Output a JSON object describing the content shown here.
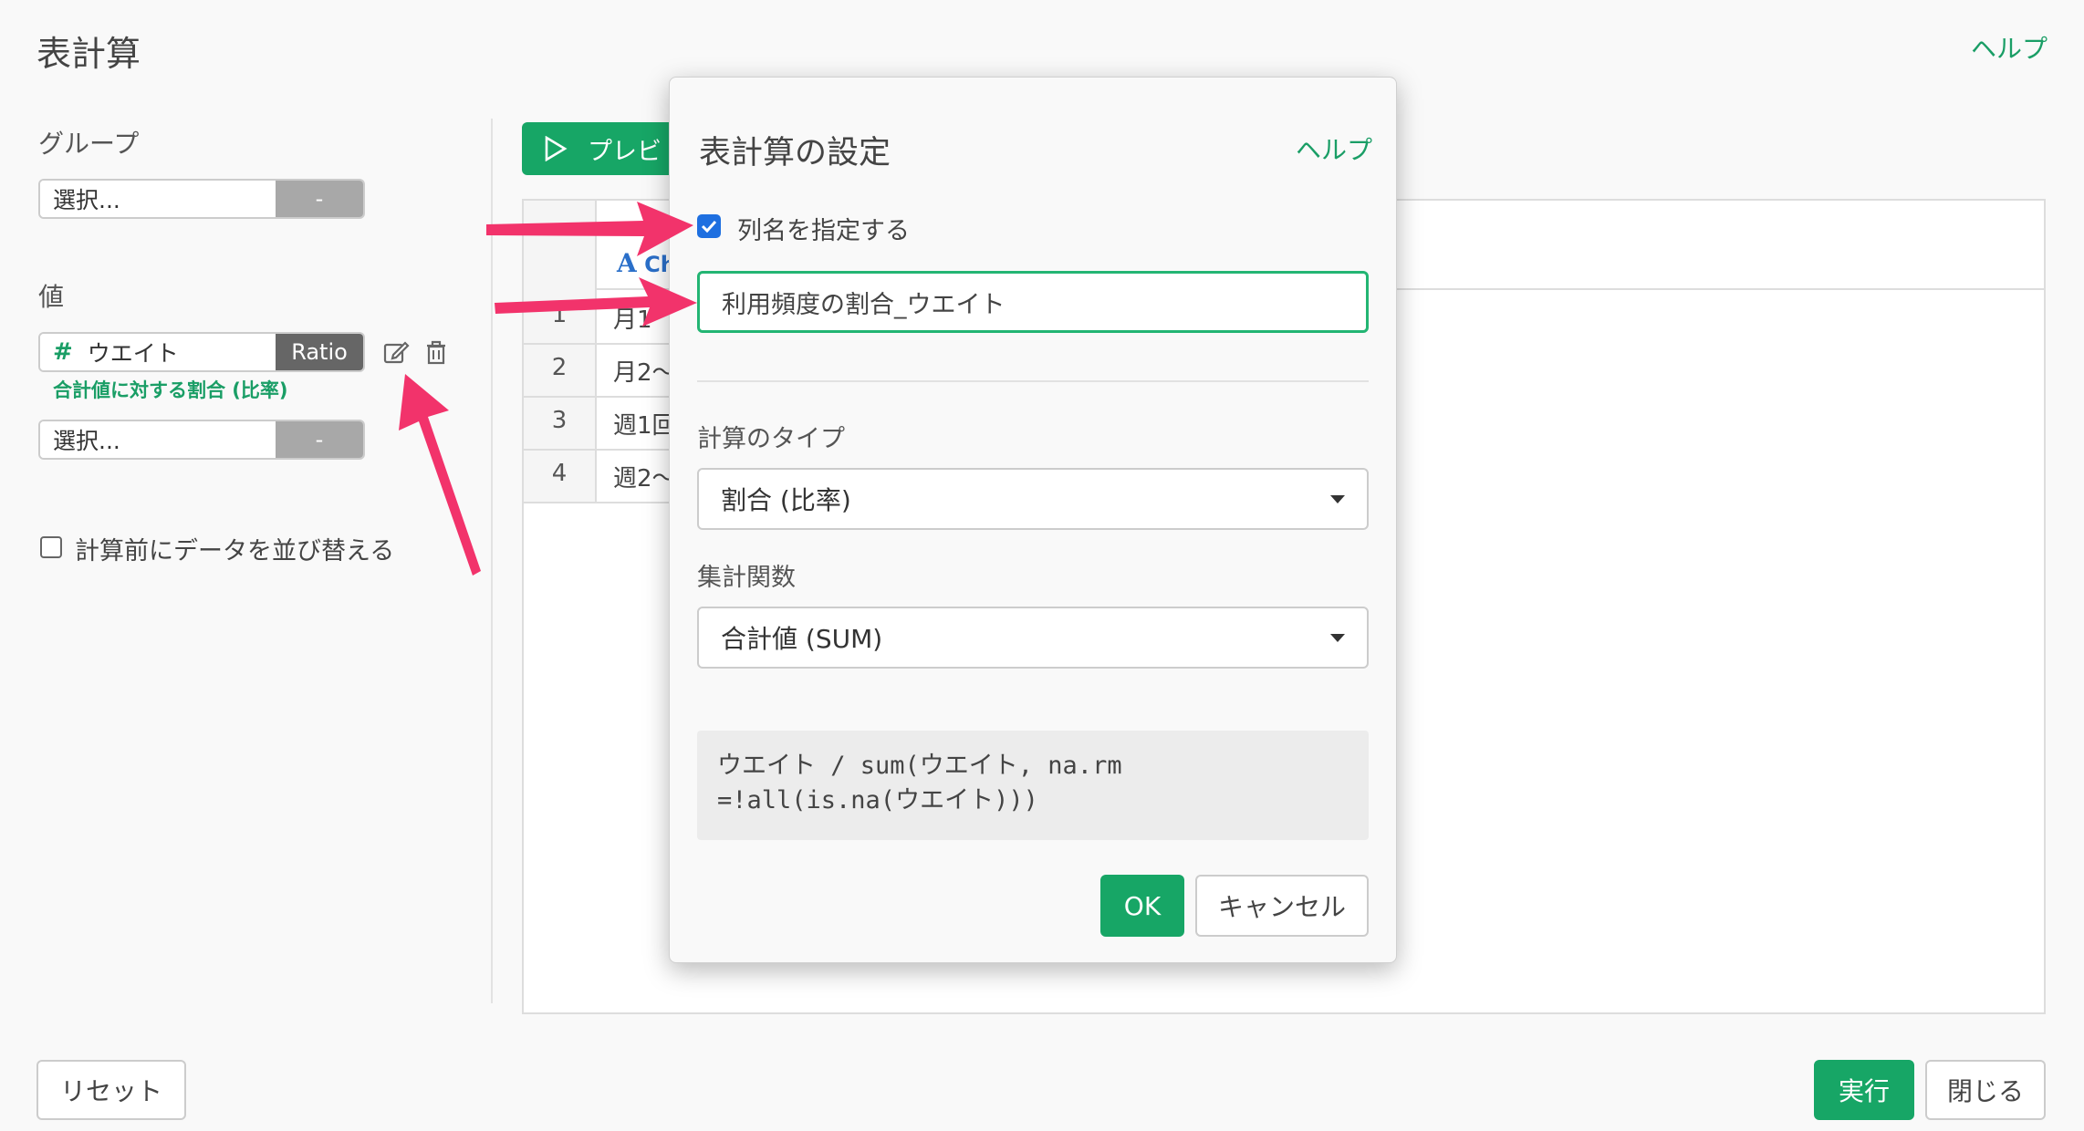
{
  "page": {
    "title": "表計算",
    "help": "ヘルプ"
  },
  "left": {
    "group_label": "グループ",
    "group_select": {
      "placeholder": "選択...",
      "side": "-"
    },
    "value_label": "値",
    "value_field": {
      "name": "ウエイト",
      "tag": "Ratio",
      "note": "合計値に対する割合 (比率)"
    },
    "value_select": {
      "placeholder": "選択...",
      "side": "-"
    },
    "sort_label": "計算前にデータを並び替える"
  },
  "preview": {
    "button": "プレビ",
    "col_type": "Ch",
    "rows": [
      {
        "num": "1",
        "text": "月1"
      },
      {
        "num": "2",
        "text": "月2〜"
      },
      {
        "num": "3",
        "text": "週1回"
      },
      {
        "num": "4",
        "text": "週2〜"
      }
    ]
  },
  "footer": {
    "reset": "リセット",
    "run": "実行",
    "close": "閉じる"
  },
  "modal": {
    "title": "表計算の設定",
    "help": "ヘルプ",
    "checkbox_label": "列名を指定する",
    "column_name": "利用頻度の割合_ウエイト",
    "calc_type_label": "計算のタイプ",
    "calc_type_value": "割合 (比率)",
    "agg_label": "集計関数",
    "agg_value": "合計値 (SUM)",
    "code_line1": "ウエイト / sum(ウエイト, na.rm",
    "code_line2": "=!all(is.na(ウエイト)))",
    "ok": "OK",
    "cancel": "キャンセル"
  },
  "colors": {
    "accent": "#17a666",
    "arrow": "#f2336b",
    "checkbox": "#1e6fe0"
  }
}
